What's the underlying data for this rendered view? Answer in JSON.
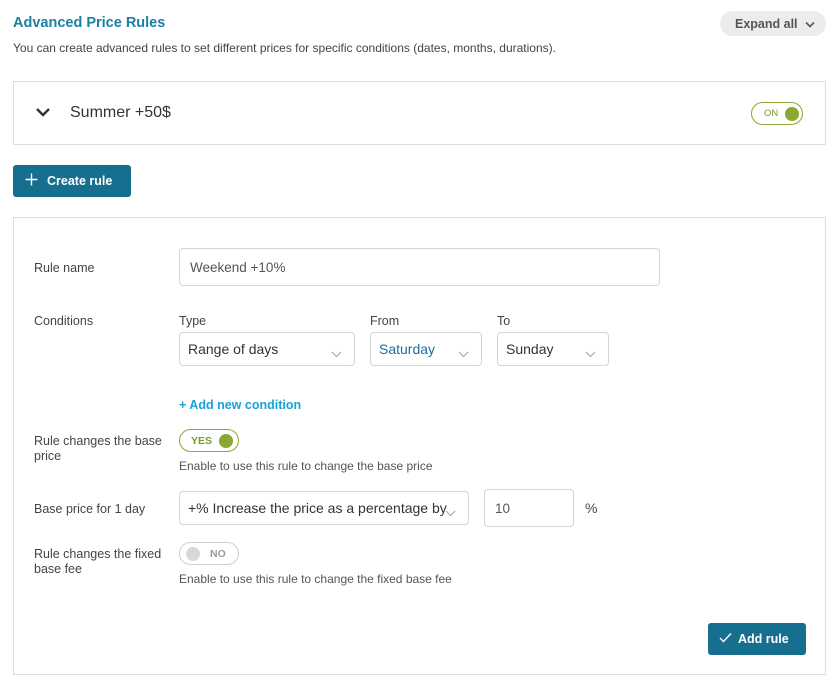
{
  "header": {
    "title": "Advanced Price Rules",
    "subtitle": "You can create advanced rules to set different prices for specific conditions (dates, months, durations).",
    "expand_label": "Expand all"
  },
  "existing_rule": {
    "name": "Summer +50$",
    "toggle_label": "ON"
  },
  "create_rule_label": "Create rule",
  "form": {
    "rule_name_label": "Rule name",
    "rule_name_value": "Weekend +10%",
    "conditions_label": "Conditions",
    "type_label": "Type",
    "type_value": "Range of days",
    "from_label": "From",
    "from_value": "Saturday",
    "to_label": "To",
    "to_value": "Sunday",
    "add_condition_label": "+ Add new condition",
    "base_price_toggle_label": "Rule changes the base price",
    "base_price_toggle_value": "YES",
    "base_price_help": "Enable to use this rule to change the base price",
    "base_price_day_label": "Base price for 1 day",
    "base_price_mode_value": "+% Increase the price as a percentage by",
    "base_price_amount": "10",
    "percent_symbol": "%",
    "fixed_fee_toggle_label": "Rule changes the fixed base fee",
    "fixed_fee_toggle_value": "NO",
    "fixed_fee_help": "Enable to use this rule to change the fixed base fee",
    "add_rule_label": "Add rule"
  },
  "colors": {
    "accent": "#166f8e",
    "title": "#1b7fa6",
    "link": "#1aa2d6",
    "toggle_on": "#8aa832"
  },
  "icons": {
    "expand": "chevron-down-icon",
    "rule_collapse": "chevron-down-icon",
    "create": "plus-icon",
    "add_rule": "check-icon"
  }
}
